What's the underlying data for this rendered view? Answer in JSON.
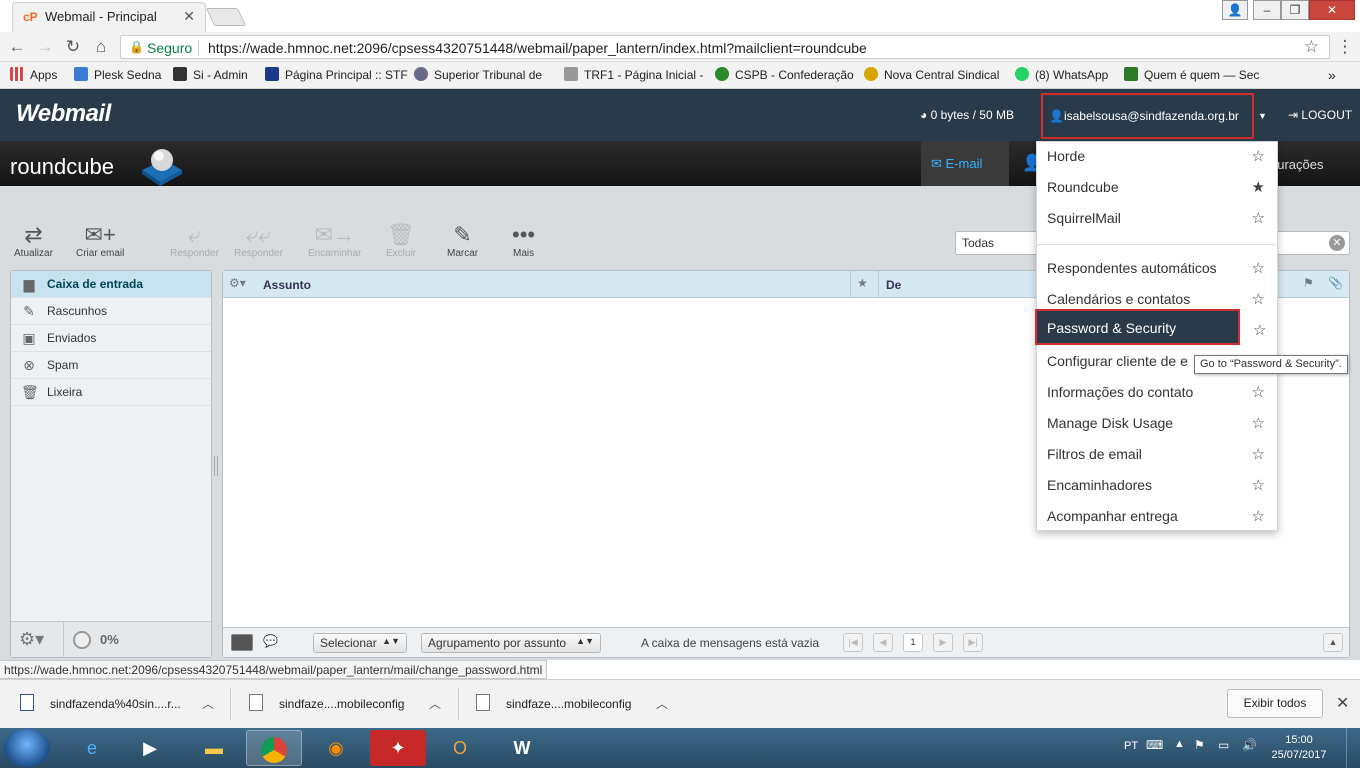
{
  "browser": {
    "tab_title": "Webmail - Principal",
    "secure_label": "Seguro",
    "url": "https://wade.hmnoc.net:2096/cpsess4320751448/webmail/paper_lantern/index.html?mailclient=roundcube",
    "status_url": "https://wade.hmnoc.net:2096/cpsess4320751448/webmail/paper_lantern/mail/change_password.html",
    "bookmarks": [
      {
        "label": "Apps",
        "color": "#d44"
      },
      {
        "label": "Plesk Sedna",
        "color": "#3a7bd5"
      },
      {
        "label": "Si - Admin",
        "color": "#333"
      },
      {
        "label": "Página Principal :: STF",
        "color": "#1a3a8a"
      },
      {
        "label": "Superior Tribunal de",
        "color": "#6a6a8a"
      },
      {
        "label": "TRF1 - Página Inicial -",
        "color": "#777"
      },
      {
        "label": "CSPB - Confederação",
        "color": "#2a8a2a"
      },
      {
        "label": "Nova Central Sindical",
        "color": "#d8a400"
      },
      {
        "label": "(8) WhatsApp",
        "color": "#25d366"
      },
      {
        "label": "Quem é quem — Sec",
        "color": "#2a7a2a"
      }
    ]
  },
  "cpanel": {
    "logo": "Webmail",
    "quota": "0 bytes / 50 MB",
    "user_email": "isabelsousa@sindfazenda.org.br",
    "logout": "LOGOUT"
  },
  "roundcube": {
    "logo": "roundcube",
    "email_tab": "E-mail",
    "settings_tab": "gurações"
  },
  "toolbar": {
    "refresh": "Atualizar",
    "compose": "Criar email",
    "reply": "Responder",
    "reply_all": "Responder",
    "forward": "Encaminhar",
    "delete": "Excluir",
    "mark": "Marcar",
    "more": "Mais"
  },
  "search": {
    "scope": "Todas"
  },
  "folders": [
    {
      "label": "Caixa de entrada",
      "icon": "inbox-icon",
      "glyph": "▆"
    },
    {
      "label": "Rascunhos",
      "icon": "pencil-icon",
      "glyph": "✎"
    },
    {
      "label": "Enviados",
      "icon": "sent-icon",
      "glyph": "▣"
    },
    {
      "label": "Spam",
      "icon": "spam-icon",
      "glyph": "⊗"
    },
    {
      "label": "Lixeira",
      "icon": "trash-icon",
      "glyph": "🗑"
    }
  ],
  "folder_quota": "0%",
  "message_list": {
    "col_subject": "Assunto",
    "col_from": "De",
    "select_label": "Selecionar",
    "threads_label": "Agrupamento por assunto",
    "empty_text": "A caixa de mensagens está vazia",
    "page": "1"
  },
  "dropdown": {
    "items_top": [
      "Horde",
      "Roundcube",
      "SquirrelMail"
    ],
    "items_bottom": [
      "Respondentes automáticos",
      "Calendários e contatos",
      "Password & Security",
      "Configurar cliente de e",
      "Informações do contato",
      "Manage Disk Usage",
      "Filtros de email",
      "Encaminhadores",
      "Acompanhar entrega"
    ],
    "favorite": "Roundcube"
  },
  "tooltip": "Go to “Password & Security”.",
  "downloads": {
    "items": [
      "sindfazenda%40sin....r...",
      "sindfaze....mobileconfig",
      "sindfaze....mobileconfig"
    ],
    "show_all": "Exibir todos"
  },
  "taskbar": {
    "lang": "PT",
    "time": "15:00",
    "date": "25/07/2017"
  }
}
